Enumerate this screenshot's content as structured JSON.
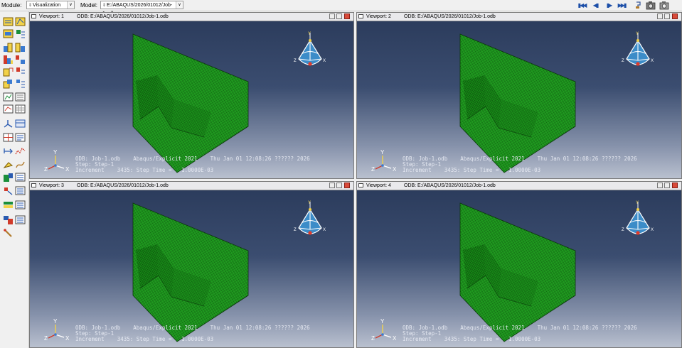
{
  "toolbar": {
    "module_label": "Module:",
    "module_value": "Visualization",
    "model_label": "Model:",
    "model_value": "E:/ABAQUS/2026/01012/Job-1.odb"
  },
  "viewports": [
    {
      "title": "Viewport: 1",
      "odb_path": "ODB: E:/ABAQUS/2026/01012/Job-1.odb",
      "odb_line": "ODB: Job-1.odb    Abaqus/Explicit 2021    Thu Jan 01 12:08:26 ?????? 2026",
      "step_line": "Step: Step-1",
      "increment_line": "Increment    3435: Step Time =   1.0000E-03"
    },
    {
      "title": "Viewport: 2",
      "odb_path": "ODB: E:/ABAQUS/2026/01012/Job-1.odb",
      "odb_line": "ODB: Job-1.odb    Abaqus/Explicit 2021    Thu Jan 01 12:08:26 ?????? 2026",
      "step_line": "Step: Step-1",
      "increment_line": "Increment    3435: Step Time =   1.0000E-03"
    },
    {
      "title": "Viewport: 3",
      "odb_path": "ODB: E:/ABAQUS/2026/01012/Job-1.odb",
      "odb_line": "ODB: Job-1.odb    Abaqus/Explicit 2021    Thu Jan 01 12:08:26 ?????? 2026",
      "step_line": "Step: Step-1",
      "increment_line": "Increment    3435: Step Time =   1.0000E-03"
    },
    {
      "title": "Viewport: 4",
      "odb_path": "ODB: E:/ABAQUS/2026/01012/Job-1.odb",
      "odb_line": "ODB: Job-1.odb    Abaqus/Explicit 2021    Thu Jan 01 12:08:26 ?????? 2026",
      "step_line": "Step: Step-1",
      "increment_line": "Increment    3435: Step Time =   1.0000E-03"
    }
  ],
  "triad_labels": {
    "x": "X",
    "y": "Y",
    "z": "Z"
  },
  "colors": {
    "mesh": "#1f9a1f",
    "mesh_edge": "#0c3f0c",
    "bg_top": "#2a3a5a",
    "bg_bottom": "#b9c0cf"
  },
  "icons": [
    "first-frame-icon",
    "previous-frame-icon",
    "next-frame-icon",
    "last-frame-icon",
    "camera-icon"
  ]
}
